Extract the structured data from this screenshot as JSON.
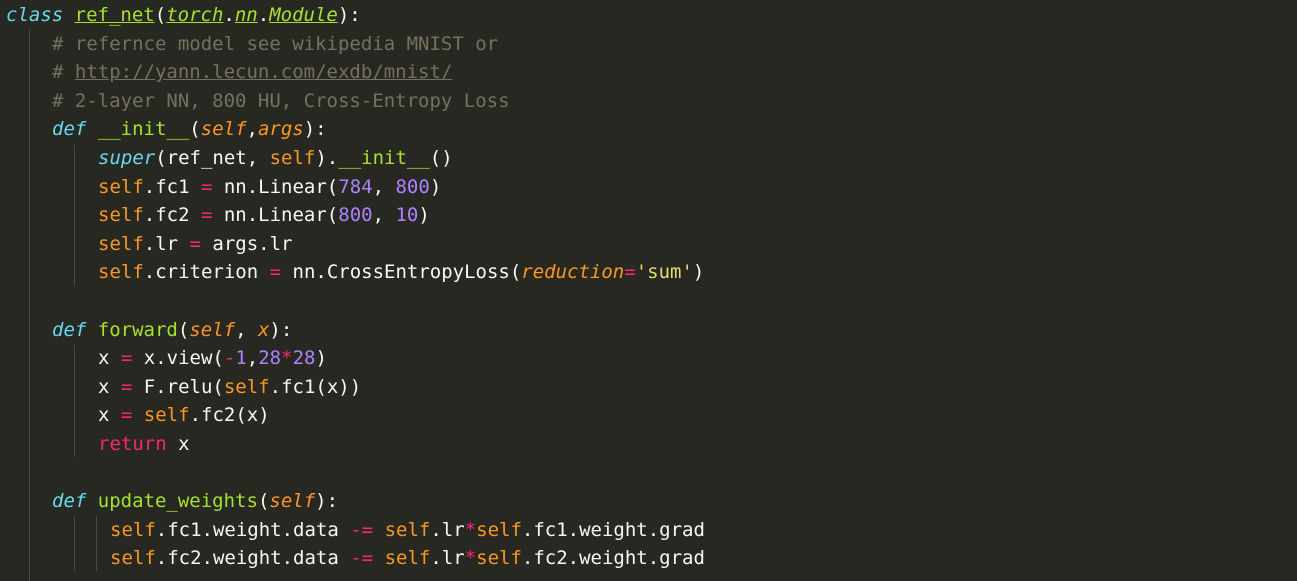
{
  "editor": {
    "theme_colors": {
      "background": "#272822",
      "keyword": "#66d9ef",
      "function": "#a6e22e",
      "self": "#fd971f",
      "operator": "#f92672",
      "number": "#ae81ff",
      "string": "#e6db74",
      "comment": "#75715e",
      "text": "#f8f8f2"
    },
    "lines": [
      {
        "tokens": [
          [
            "kw",
            "class"
          ],
          [
            "pl",
            " "
          ],
          [
            "cls",
            "ref_net"
          ],
          [
            "pl",
            "("
          ],
          [
            "inh",
            "torch"
          ],
          [
            "pl",
            "."
          ],
          [
            "inh",
            "nn"
          ],
          [
            "pl",
            "."
          ],
          [
            "inh",
            "Module"
          ],
          [
            "pl",
            "):"
          ]
        ]
      },
      {
        "tokens": [
          [
            "cmt",
            "# refernce model see wikipedia MNIST or"
          ]
        ]
      },
      {
        "tokens": [
          [
            "cmt",
            "# "
          ],
          [
            "cmt-url",
            "http://yann.lecun.com/exdb/mnist/"
          ]
        ]
      },
      {
        "tokens": [
          [
            "cmt",
            "# 2-layer NN, 800 HU, Cross-Entropy Loss"
          ]
        ]
      },
      {
        "tokens": [
          [
            "kw",
            "def"
          ],
          [
            "pl",
            " "
          ],
          [
            "fn",
            "__init__"
          ],
          [
            "pl",
            "("
          ],
          [
            "par",
            "self"
          ],
          [
            "pl",
            ","
          ],
          [
            "par",
            "args"
          ],
          [
            "pl",
            "):"
          ]
        ]
      },
      {
        "tokens": [
          [
            "kw",
            "super"
          ],
          [
            "pl",
            "(ref_net, "
          ],
          [
            "slf",
            "self"
          ],
          [
            "pl",
            ")."
          ],
          [
            "fn",
            "__init__"
          ],
          [
            "pl",
            "()"
          ]
        ]
      },
      {
        "tokens": [
          [
            "slf",
            "self"
          ],
          [
            "pl",
            ".fc1 "
          ],
          [
            "op",
            "="
          ],
          [
            "pl",
            " nn.Linear("
          ],
          [
            "num",
            "784"
          ],
          [
            "pl",
            ", "
          ],
          [
            "num",
            "800"
          ],
          [
            "pl",
            ")"
          ]
        ]
      },
      {
        "tokens": [
          [
            "slf",
            "self"
          ],
          [
            "pl",
            ".fc2 "
          ],
          [
            "op",
            "="
          ],
          [
            "pl",
            " nn.Linear("
          ],
          [
            "num",
            "800"
          ],
          [
            "pl",
            ", "
          ],
          [
            "num",
            "10"
          ],
          [
            "pl",
            ")"
          ]
        ]
      },
      {
        "tokens": [
          [
            "slf",
            "self"
          ],
          [
            "pl",
            ".lr "
          ],
          [
            "op",
            "="
          ],
          [
            "pl",
            " args.lr"
          ]
        ]
      },
      {
        "tokens": [
          [
            "slf",
            "self"
          ],
          [
            "pl",
            ".criterion "
          ],
          [
            "op",
            "="
          ],
          [
            "pl",
            " nn.CrossEntropyLoss("
          ],
          [
            "par",
            "reduction"
          ],
          [
            "op",
            "="
          ],
          [
            "str",
            "'sum'"
          ],
          [
            "pl",
            ")"
          ]
        ]
      },
      {
        "tokens": []
      },
      {
        "tokens": [
          [
            "kw",
            "def"
          ],
          [
            "pl",
            " "
          ],
          [
            "fn",
            "forward"
          ],
          [
            "pl",
            "("
          ],
          [
            "par",
            "self"
          ],
          [
            "pl",
            ", "
          ],
          [
            "par",
            "x"
          ],
          [
            "pl",
            "):"
          ]
        ]
      },
      {
        "tokens": [
          [
            "pl",
            "x "
          ],
          [
            "op",
            "="
          ],
          [
            "pl",
            " x.view("
          ],
          [
            "op",
            "-"
          ],
          [
            "num",
            "1"
          ],
          [
            "pl",
            ","
          ],
          [
            "num",
            "28"
          ],
          [
            "op",
            "*"
          ],
          [
            "num",
            "28"
          ],
          [
            "pl",
            ")"
          ]
        ]
      },
      {
        "tokens": [
          [
            "pl",
            "x "
          ],
          [
            "op",
            "="
          ],
          [
            "pl",
            " F.relu("
          ],
          [
            "slf",
            "self"
          ],
          [
            "pl",
            ".fc1(x))"
          ]
        ]
      },
      {
        "tokens": [
          [
            "pl",
            "x "
          ],
          [
            "op",
            "="
          ],
          [
            "pl",
            " "
          ],
          [
            "slf",
            "self"
          ],
          [
            "pl",
            ".fc2(x)"
          ]
        ]
      },
      {
        "tokens": [
          [
            "op",
            "return"
          ],
          [
            "pl",
            " x"
          ]
        ]
      },
      {
        "tokens": []
      },
      {
        "tokens": [
          [
            "kw",
            "def"
          ],
          [
            "pl",
            " "
          ],
          [
            "fn",
            "update_weights"
          ],
          [
            "pl",
            "("
          ],
          [
            "par",
            "self"
          ],
          [
            "pl",
            "):"
          ]
        ]
      },
      {
        "tokens": [
          [
            "slf",
            "self"
          ],
          [
            "pl",
            ".fc1.weight.data "
          ],
          [
            "op",
            "-="
          ],
          [
            "pl",
            " "
          ],
          [
            "slf",
            "self"
          ],
          [
            "pl",
            ".lr"
          ],
          [
            "op",
            "*"
          ],
          [
            "slf",
            "self"
          ],
          [
            "pl",
            ".fc1.weight.grad"
          ]
        ]
      },
      {
        "tokens": [
          [
            "slf",
            "self"
          ],
          [
            "pl",
            ".fc2.weight.data "
          ],
          [
            "op",
            "-="
          ],
          [
            "pl",
            " "
          ],
          [
            "slf",
            "self"
          ],
          [
            "pl",
            ".lr"
          ],
          [
            "op",
            "*"
          ],
          [
            "slf",
            "self"
          ],
          [
            "pl",
            ".fc2.weight.grad"
          ]
        ]
      }
    ]
  }
}
